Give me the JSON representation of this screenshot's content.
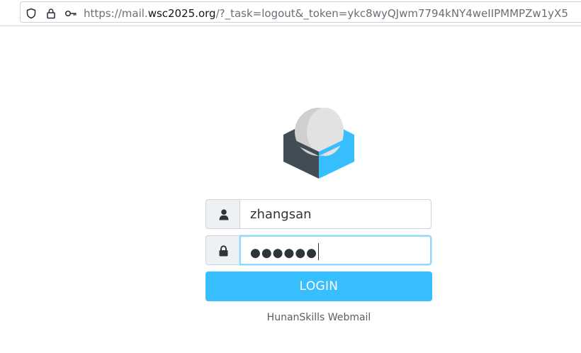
{
  "browser": {
    "url_prefix": "https://mail.",
    "url_domain": "wsc2025.org",
    "url_path": "/?_task=logout&_token=ykc8wyQJwm7794kNY4weIIPMMPZw1yX5"
  },
  "login": {
    "username_value": "zhangsan",
    "password_masked": "●●●●●●",
    "button_label": "LOGIN",
    "footer_text": "HunanSkills Webmail"
  },
  "colors": {
    "accent": "#37beff",
    "logo_dark": "#414d54",
    "logo_light": "#37beff"
  }
}
